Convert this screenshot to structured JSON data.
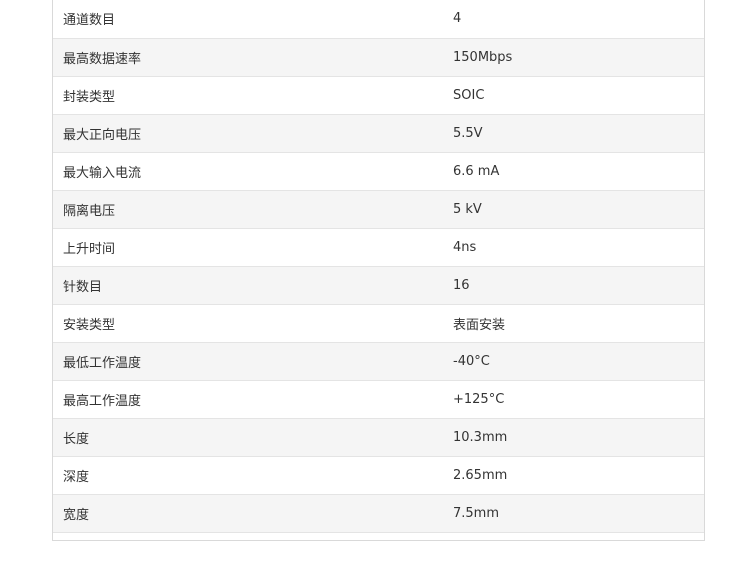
{
  "specs": {
    "rows": [
      {
        "label": "通道数目",
        "value": "4"
      },
      {
        "label": "最高数据速率",
        "value": "150Mbps"
      },
      {
        "label": "封装类型",
        "value": "SOIC"
      },
      {
        "label": "最大正向电压",
        "value": "5.5V"
      },
      {
        "label": "最大输入电流",
        "value": "6.6 mA"
      },
      {
        "label": "隔离电压",
        "value": "5 kV"
      },
      {
        "label": "上升时间",
        "value": "4ns"
      },
      {
        "label": "针数目",
        "value": "16"
      },
      {
        "label": "安装类型",
        "value": "表面安装"
      },
      {
        "label": "最低工作温度",
        "value": "-40°C"
      },
      {
        "label": "最高工作温度",
        "value": "+125°C"
      },
      {
        "label": "长度",
        "value": "10.3mm"
      },
      {
        "label": "深度",
        "value": "2.65mm"
      },
      {
        "label": "宽度",
        "value": "7.5mm"
      }
    ]
  }
}
